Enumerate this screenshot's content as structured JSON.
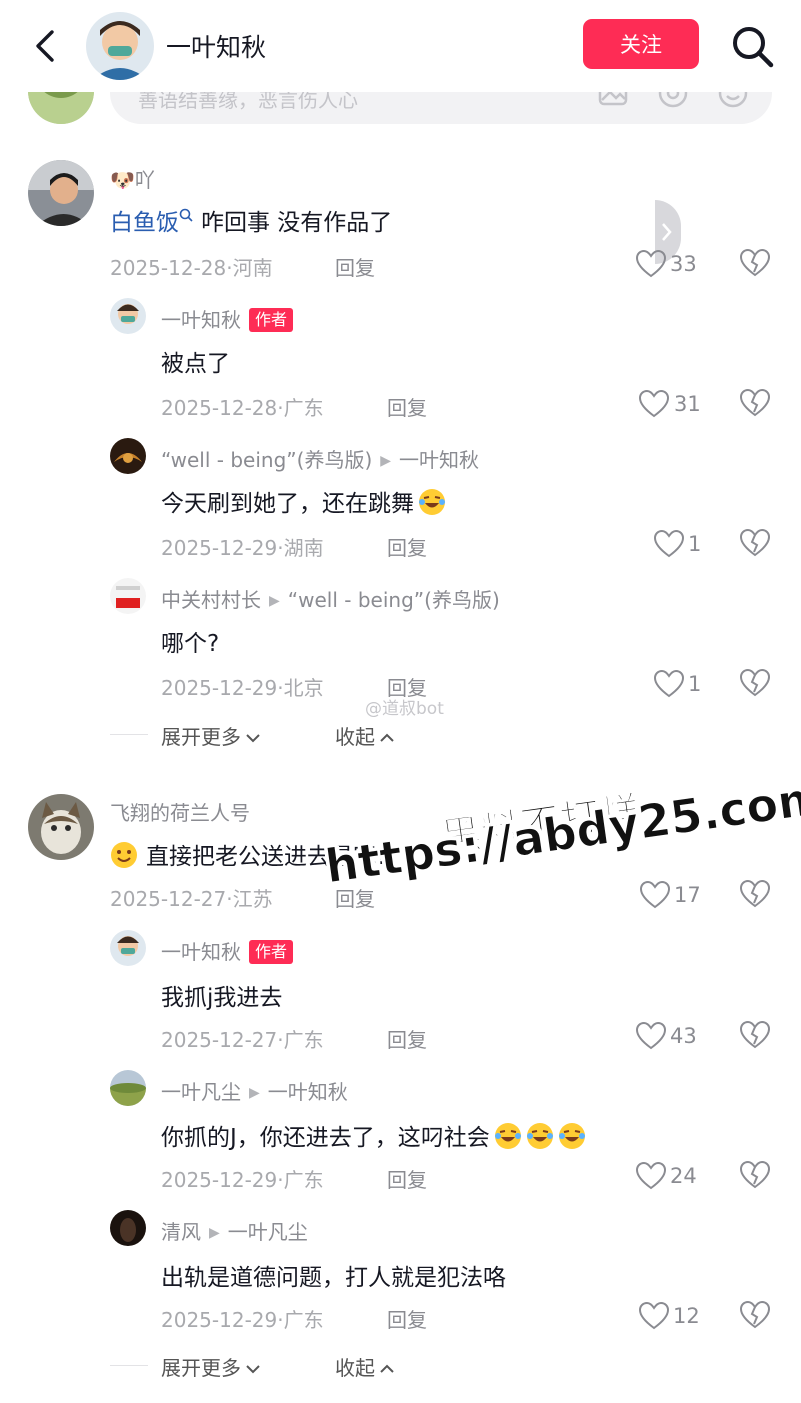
{
  "header": {
    "title": "一叶知秋",
    "follow_label": "关注"
  },
  "input": {
    "placeholder": "善语结善缘，恶言伤人心"
  },
  "comments": [
    {
      "user": "🐶吖",
      "link_name": "白鱼饭",
      "text": "咋回事 没有作品了",
      "date": "2025-12-28",
      "location": "河南",
      "reply_label": "回复",
      "likes": "33",
      "replies": [
        {
          "user": "一叶知秋",
          "tag": "作者",
          "text": "被点了",
          "date": "2025-12-28",
          "location": "广东",
          "reply_label": "回复",
          "likes": "31"
        },
        {
          "user": "“well - being”(养鸟版)",
          "reply_to": "一叶知秋",
          "text": "今天刷到她了，还在跳舞",
          "date": "2025-12-29",
          "location": "湖南",
          "reply_label": "回复",
          "likes": "1"
        },
        {
          "user": "中关村村长",
          "reply_to": "“well - being”(养鸟版)",
          "text": "哪个?",
          "date": "2025-12-29",
          "location": "北京",
          "reply_label": "回复",
          "likes": "1"
        }
      ],
      "expand_label": "展开更多",
      "collapse_label": "收起"
    },
    {
      "user": "飞翔的荷兰人号",
      "text": "直接把老公送进去是吧?",
      "date": "2025-12-27",
      "location": "江苏",
      "reply_label": "回复",
      "likes": "17",
      "replies": [
        {
          "user": "一叶知秋",
          "tag": "作者",
          "text": "我抓j我进去",
          "date": "2025-12-27",
          "location": "广东",
          "reply_label": "回复",
          "likes": "43"
        },
        {
          "user": "一叶凡尘",
          "reply_to": "一叶知秋",
          "text": "你抓的J，你还进去了，这叼社会",
          "date": "2025-12-29",
          "location": "广东",
          "reply_label": "回复",
          "likes": "24"
        },
        {
          "user": "清风",
          "reply_to": "一叶凡尘",
          "text": "出轨是道德问题，打人就是犯法咯",
          "date": "2025-12-29",
          "location": "广东",
          "reply_label": "回复",
          "likes": "12"
        }
      ],
      "expand_label": "展开更多",
      "collapse_label": "收起"
    }
  ],
  "watermark": {
    "small": "@道叔bot",
    "overlay_line1": "黑料不打烊",
    "overlay_line2": "https://abdy25.com"
  },
  "colors": {
    "accent": "#fe2c55",
    "link": "#2a5db0",
    "meta": "#a8a9ad"
  }
}
